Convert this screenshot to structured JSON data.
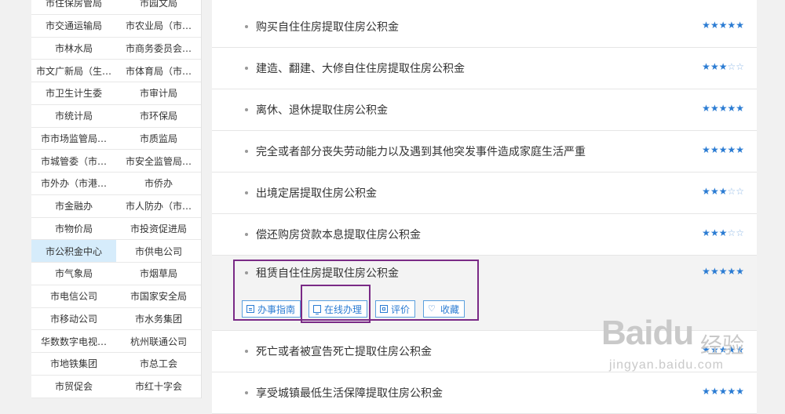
{
  "departments": [
    "市住保房管局",
    "市园文局",
    "市交通运输局",
    "市农业局（市…",
    "市林水局",
    "市商务委员会…",
    "市文广新局（生…",
    "市体育局（市…",
    "市卫生计生委",
    "市审计局",
    "市统计局",
    "市环保局",
    "市市场监管局…",
    "市质监局",
    "市城管委（市…",
    "市安全监管局…",
    "市外办（市港…",
    "市侨办",
    "市金融办",
    "市人防办（市…",
    "市物价局",
    "市投资促进局",
    "市公积金中心",
    "市供电公司",
    "市气象局",
    "市烟草局",
    "市电信公司",
    "市国家安全局",
    "市移动公司",
    "市水务集团",
    "华数数字电视…",
    "杭州联通公司",
    "市地铁集团",
    "市总工会",
    "市贸促会",
    "市红十字会"
  ],
  "active_department": "市公积金中心",
  "items": [
    {
      "title": "购买自住住房提取住房公积金",
      "rating": 5
    },
    {
      "title": "建造、翻建、大修自住住房提取住房公积金",
      "rating": 3
    },
    {
      "title": "离休、退休提取住房公积金",
      "rating": 5
    },
    {
      "title": "完全或者部分丧失劳动能力以及遇到其他突发事件造成家庭生活严重",
      "rating": 5
    },
    {
      "title": "出境定居提取住房公积金",
      "rating": 3
    },
    {
      "title": "偿还购房贷款本息提取住房公积金",
      "rating": 3
    },
    {
      "title": "租赁自住住房提取住房公积金",
      "rating": 5
    },
    {
      "title": "死亡或者被宣告死亡提取住房公积金",
      "rating": 5
    },
    {
      "title": "享受城镇最低生活保障提取住房公积金",
      "rating": 5
    }
  ],
  "actions": {
    "guide": "办事指南",
    "online": "在线办理",
    "review": "评价",
    "favorite": "收藏",
    "icons": [
      "guide-icon",
      "monitor-icon",
      "review-icon",
      "heart-icon"
    ]
  },
  "watermark": {
    "logo": "Baidu",
    "cn": "经验",
    "url": "jingyan.baidu.com"
  },
  "colors": {
    "accent": "#2b7cd3",
    "active_bg": "#d6ecfb",
    "highlight": "#7a2a86"
  }
}
